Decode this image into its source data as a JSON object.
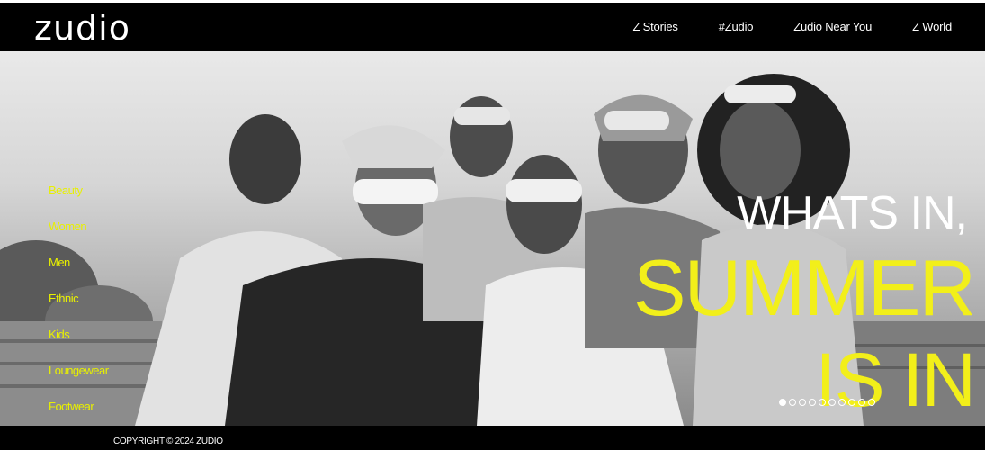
{
  "brand": {
    "logo": "zudio"
  },
  "nav": [
    {
      "label": "Z Stories"
    },
    {
      "label": "#Zudio"
    },
    {
      "label": "Zudio Near You"
    },
    {
      "label": "Z World"
    }
  ],
  "side_menu": [
    {
      "label": "Beauty"
    },
    {
      "label": "Women"
    },
    {
      "label": "Men"
    },
    {
      "label": "Ethnic"
    },
    {
      "label": "Kids"
    },
    {
      "label": "Loungewear"
    },
    {
      "label": "Footwear"
    }
  ],
  "hero": {
    "line1": "WHATS IN,",
    "line2": "SUMMER",
    "line3": "IS IN",
    "slides_total": 10,
    "active_slide": 1,
    "accent_color": "#f2ef1a"
  },
  "footer": {
    "copyright": "COPYRIGHT © 2024 ZUDIO"
  }
}
